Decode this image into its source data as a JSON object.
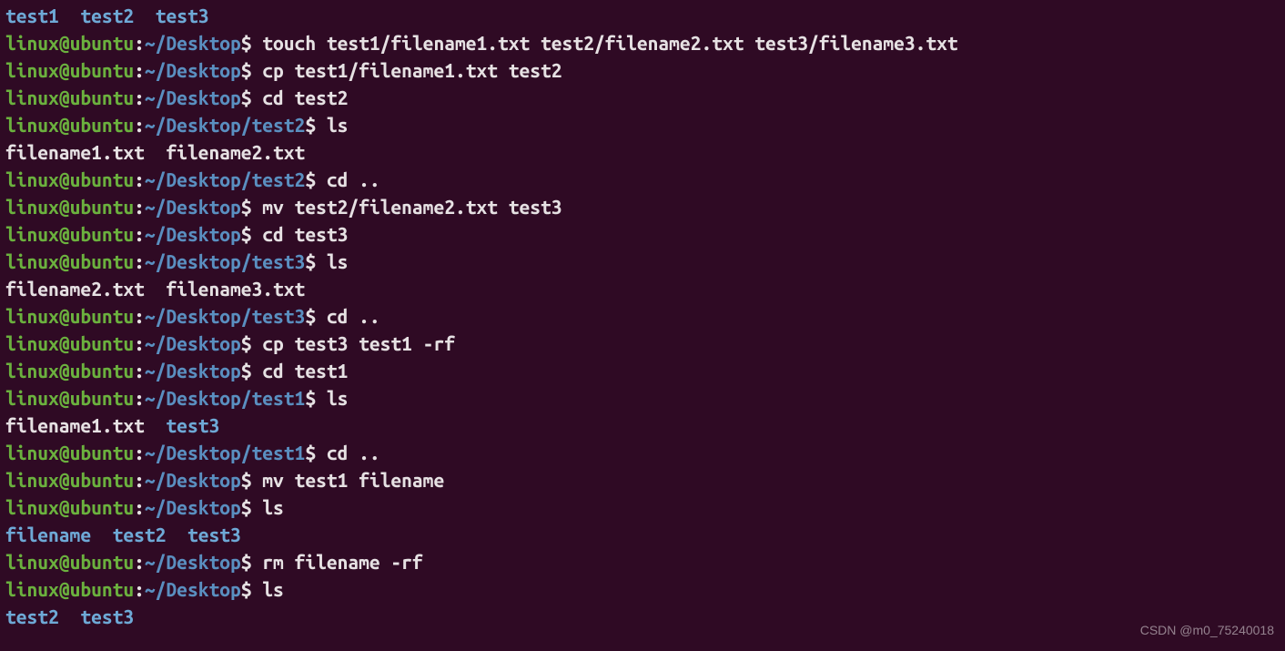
{
  "colors": {
    "bg": "#2f0a24",
    "dir": "#6ea9d6",
    "user": "#6bb13e",
    "path": "#5a8fc0",
    "text": "#e6e1e3"
  },
  "watermark": "CSDN @m0_75240018",
  "lines": [
    {
      "type": "dir_listing",
      "items": [
        "test1",
        "test2",
        "test3"
      ]
    },
    {
      "type": "prompt",
      "user": "linux",
      "host": "ubuntu",
      "path": "~/Desktop",
      "command": "touch test1/filename1.txt test2/filename2.txt test3/filename3.txt"
    },
    {
      "type": "prompt",
      "user": "linux",
      "host": "ubuntu",
      "path": "~/Desktop",
      "command": "cp test1/filename1.txt test2"
    },
    {
      "type": "prompt",
      "user": "linux",
      "host": "ubuntu",
      "path": "~/Desktop",
      "command": "cd test2"
    },
    {
      "type": "prompt",
      "user": "linux",
      "host": "ubuntu",
      "path": "~/Desktop/test2",
      "command": "ls"
    },
    {
      "type": "output",
      "text": "filename1.txt  filename2.txt"
    },
    {
      "type": "prompt",
      "user": "linux",
      "host": "ubuntu",
      "path": "~/Desktop/test2",
      "command": "cd .."
    },
    {
      "type": "prompt",
      "user": "linux",
      "host": "ubuntu",
      "path": "~/Desktop",
      "command": "mv test2/filename2.txt test3"
    },
    {
      "type": "prompt",
      "user": "linux",
      "host": "ubuntu",
      "path": "~/Desktop",
      "command": "cd test3"
    },
    {
      "type": "prompt",
      "user": "linux",
      "host": "ubuntu",
      "path": "~/Desktop/test3",
      "command": "ls"
    },
    {
      "type": "output",
      "text": "filename2.txt  filename3.txt"
    },
    {
      "type": "prompt",
      "user": "linux",
      "host": "ubuntu",
      "path": "~/Desktop/test3",
      "command": "cd .."
    },
    {
      "type": "prompt",
      "user": "linux",
      "host": "ubuntu",
      "path": "~/Desktop",
      "command": "cp test3 test1 -rf"
    },
    {
      "type": "prompt",
      "user": "linux",
      "host": "ubuntu",
      "path": "~/Desktop",
      "command": "cd test1"
    },
    {
      "type": "prompt",
      "user": "linux",
      "host": "ubuntu",
      "path": "~/Desktop/test1",
      "command": "ls"
    },
    {
      "type": "mixed_listing",
      "items": [
        {
          "text": "filename1.txt",
          "dir": false
        },
        {
          "text": "test3",
          "dir": true
        }
      ]
    },
    {
      "type": "prompt",
      "user": "linux",
      "host": "ubuntu",
      "path": "~/Desktop/test1",
      "command": "cd .."
    },
    {
      "type": "prompt",
      "user": "linux",
      "host": "ubuntu",
      "path": "~/Desktop",
      "command": "mv test1 filename"
    },
    {
      "type": "prompt",
      "user": "linux",
      "host": "ubuntu",
      "path": "~/Desktop",
      "command": "ls"
    },
    {
      "type": "dir_listing",
      "items": [
        "filename",
        "test2",
        "test3"
      ]
    },
    {
      "type": "prompt",
      "user": "linux",
      "host": "ubuntu",
      "path": "~/Desktop",
      "command": "rm filename -rf"
    },
    {
      "type": "prompt",
      "user": "linux",
      "host": "ubuntu",
      "path": "~/Desktop",
      "command": "ls"
    },
    {
      "type": "dir_listing",
      "items": [
        "test2",
        "test3"
      ]
    }
  ]
}
